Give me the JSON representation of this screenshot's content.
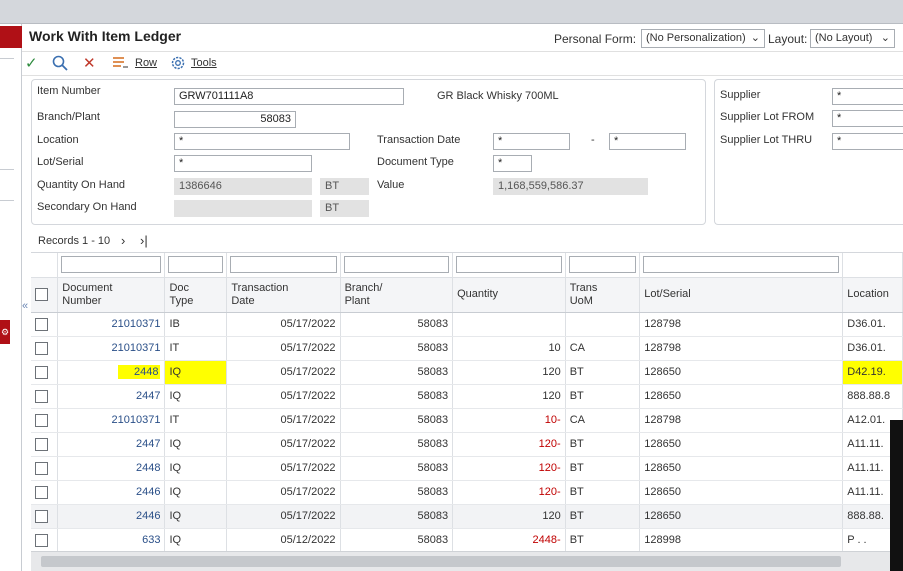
{
  "header": {
    "title": "Work With Item Ledger",
    "personal_form_label": "Personal Form:",
    "personal_form_value": "(No Personalization)",
    "layout_label": "Layout:",
    "layout_value": "(No Layout)"
  },
  "toolbar": {
    "row_label": "Row",
    "tools_label": "Tools"
  },
  "form": {
    "item_number_label": "Item Number",
    "item_number_value": "GRW701111A8",
    "item_description": "GR Black Whisky 700ML",
    "branch_plant_label": "Branch/Plant",
    "branch_plant_value": "58083",
    "location_label": "Location",
    "location_value": "*",
    "transaction_date_label": "Transaction Date",
    "transaction_date_from": "*",
    "date_separator": "-",
    "transaction_date_to": "*",
    "lot_serial_label": "Lot/Serial",
    "lot_serial_value": "*",
    "document_type_label": "Document Type",
    "document_type_value": "*",
    "qty_on_hand_label": "Quantity On Hand",
    "qty_on_hand_value": "1386646",
    "qty_uom": "BT",
    "value_label": "Value",
    "value_value": "1,168,559,586.37",
    "secondary_on_hand_label": "Secondary On Hand",
    "secondary_on_hand_value": "",
    "secondary_uom": "BT",
    "supplier_label": "Supplier",
    "supplier_value": "*",
    "supplier_lot_from_label": "Supplier Lot FROM",
    "supplier_lot_from_value": "*",
    "supplier_lot_thru_label": "Supplier Lot THRU",
    "supplier_lot_thru_value": "*"
  },
  "grid": {
    "records_label": "Records 1 - 10",
    "columns": {
      "doc_number": [
        "Document",
        "Number"
      ],
      "doc_type": [
        "Doc",
        "Type"
      ],
      "trans_date": [
        "Transaction",
        "Date"
      ],
      "branch_plant": [
        "Branch/",
        "Plant"
      ],
      "quantity": "Quantity",
      "trans_uom": [
        "Trans",
        "UoM"
      ],
      "lot_serial": "Lot/Serial",
      "location": "Location"
    },
    "rows": [
      {
        "doc": "21010371",
        "type": "IB",
        "date": "05/17/2022",
        "bp": "58083",
        "qty": "",
        "uom": "",
        "lot": "128798",
        "loc": "D36.01."
      },
      {
        "doc": "21010371",
        "type": "IT",
        "date": "05/17/2022",
        "bp": "58083",
        "qty": "10",
        "uom": "CA",
        "lot": "128798",
        "loc": "D36.01."
      },
      {
        "doc": "2448",
        "type": "IQ",
        "date": "05/17/2022",
        "bp": "58083",
        "qty": "120",
        "uom": "BT",
        "lot": "128650",
        "loc": "D42.19."
      },
      {
        "doc": "2447",
        "type": "IQ",
        "date": "05/17/2022",
        "bp": "58083",
        "qty": "120",
        "uom": "BT",
        "lot": "128650",
        "loc": "888.88.8"
      },
      {
        "doc": "21010371",
        "type": "IT",
        "date": "05/17/2022",
        "bp": "58083",
        "qty": "10-",
        "uom": "CA",
        "lot": "128798",
        "loc": "A12.01."
      },
      {
        "doc": "2447",
        "type": "IQ",
        "date": "05/17/2022",
        "bp": "58083",
        "qty": "120-",
        "uom": "BT",
        "lot": "128650",
        "loc": "A11.11."
      },
      {
        "doc": "2448",
        "type": "IQ",
        "date": "05/17/2022",
        "bp": "58083",
        "qty": "120-",
        "uom": "BT",
        "lot": "128650",
        "loc": "A11.11."
      },
      {
        "doc": "2446",
        "type": "IQ",
        "date": "05/17/2022",
        "bp": "58083",
        "qty": "120-",
        "uom": "BT",
        "lot": "128650",
        "loc": "A11.11."
      },
      {
        "doc": "2446",
        "type": "IQ",
        "date": "05/17/2022",
        "bp": "58083",
        "qty": "120",
        "uom": "BT",
        "lot": "128650",
        "loc": "888.88."
      },
      {
        "doc": "633",
        "type": "IQ",
        "date": "05/12/2022",
        "bp": "58083",
        "qty": "2448-",
        "uom": "BT",
        "lot": "128998",
        "loc": "P . ."
      }
    ]
  },
  "colors": {
    "highlight": "#ffff00",
    "negative": "#c00000",
    "link": "#2a4f88",
    "brand_red": "#b01016"
  }
}
